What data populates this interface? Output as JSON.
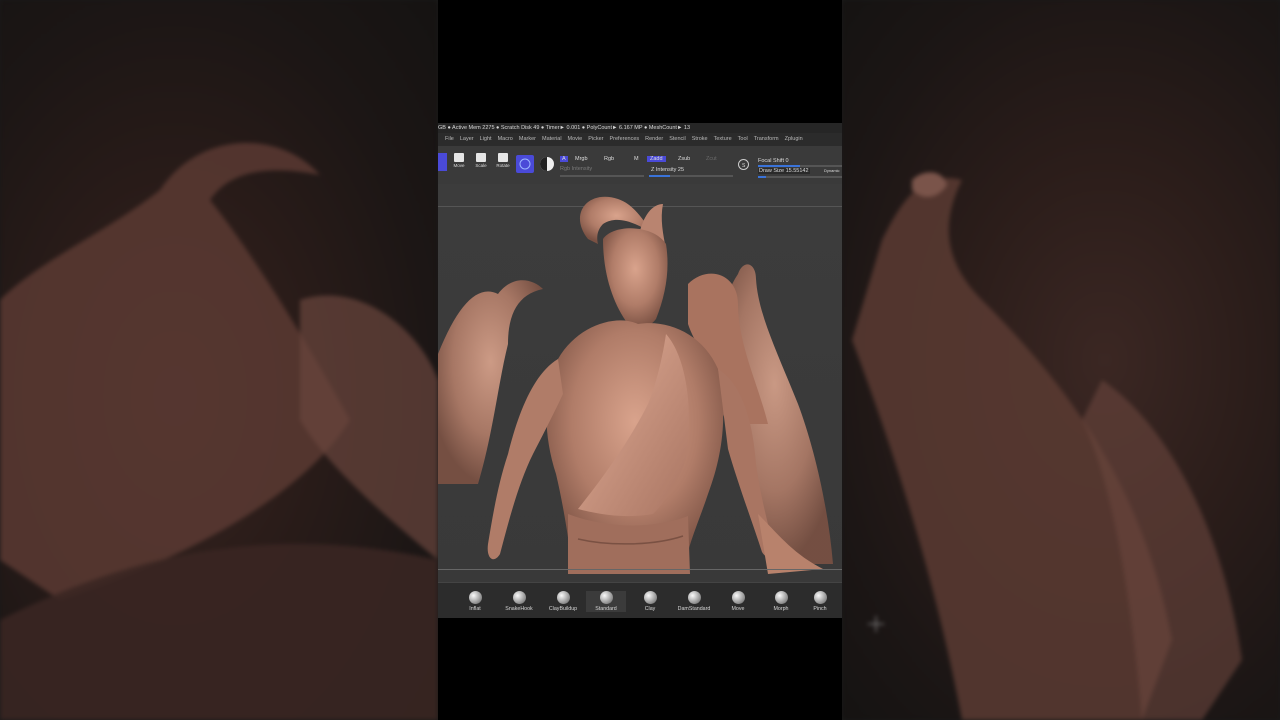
{
  "status": {
    "text": "GB ● Active Mem 2275 ● Scratch Disk 49 ● Timer► 0.001 ● PolyCount► 6.167 MP ● MeshCount► 13"
  },
  "menu": {
    "items": [
      "File",
      "Layer",
      "Light",
      "Macro",
      "Marker",
      "Material",
      "Movie",
      "Picker",
      "Preferences",
      "Render",
      "Stencil",
      "Stroke",
      "Texture",
      "Tool",
      "Transform",
      "Zplugin"
    ]
  },
  "toolbar": {
    "move_label": "Move",
    "scale_label": "Scale",
    "rotate_label": "Rotate",
    "a_label": "A",
    "mrgb_label": "Mrgb",
    "rgb_label": "Rgb",
    "m_label": "M",
    "rgb_intensity_label": "Rgb Intensity",
    "zadd_label": "Zadd",
    "zsub_label": "Zsub",
    "zcut_label": "Zcut",
    "z_intensity_label": "Z Intensity 25",
    "z_intensity_value": 25,
    "focal_shift_label": "Focal Shift 0",
    "draw_size_label": "Draw Size 15.55142",
    "dynamic_label": "Dynamic"
  },
  "brushes": [
    {
      "label": "Inflat"
    },
    {
      "label": "SnakeHook"
    },
    {
      "label": "ClayBuildup"
    },
    {
      "label": "Standard"
    },
    {
      "label": "Clay"
    },
    {
      "label": "DamStandard"
    },
    {
      "label": "Move"
    },
    {
      "label": "Morph"
    },
    {
      "label": "Pinch"
    }
  ],
  "colors": {
    "accent": "#4a4ad8",
    "clay": "#b88470"
  }
}
